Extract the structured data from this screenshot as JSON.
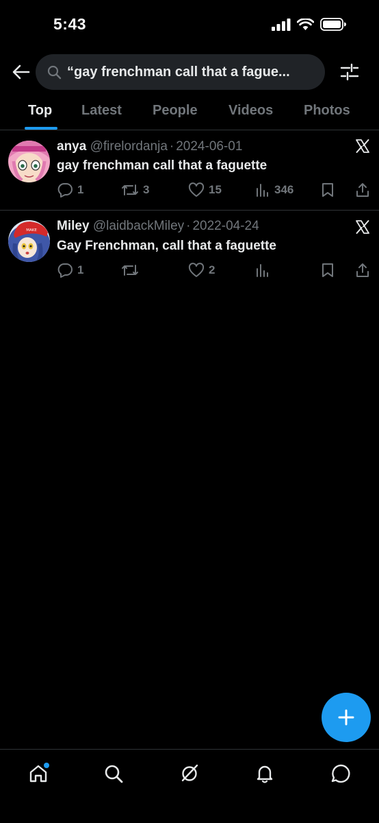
{
  "status_bar": {
    "time": "5:43"
  },
  "search": {
    "query": "“gay frenchman call that a fague..."
  },
  "tabs": [
    {
      "label": "Top",
      "active": true
    },
    {
      "label": "Latest",
      "active": false
    },
    {
      "label": "People",
      "active": false
    },
    {
      "label": "Videos",
      "active": false
    },
    {
      "label": "Photos",
      "active": false
    }
  ],
  "tweets": [
    {
      "name": "anya",
      "handle": "@firelordanja",
      "separator": "·",
      "date": "2024-06-01",
      "text": "gay frenchman call that a faguette",
      "replies": "1",
      "retweets": "3",
      "likes": "15",
      "views": "346"
    },
    {
      "name": "Miley",
      "handle": "@laidbackMiley",
      "separator": "·",
      "date": "2022-04-24",
      "text": "Gay Frenchman, call that a faguette",
      "replies": "1",
      "retweets": "",
      "likes": "2",
      "views": ""
    }
  ],
  "icons": {
    "back": "arrow-left-icon",
    "search": "search-icon",
    "filter": "sliders-icon",
    "reply": "speech-bubble-icon",
    "retweet": "retweet-icon",
    "like": "heart-icon",
    "views": "bar-chart-icon",
    "bookmark": "bookmark-icon",
    "share": "share-icon",
    "compose": "plus-icon",
    "nav": [
      "home-icon",
      "search-icon",
      "grok-icon",
      "bell-icon",
      "message-icon"
    ]
  },
  "colors": {
    "background": "#000000",
    "accent": "#1d9bf0",
    "text": "#e7e9ea",
    "muted": "#71767b",
    "search_bg": "#202327"
  }
}
